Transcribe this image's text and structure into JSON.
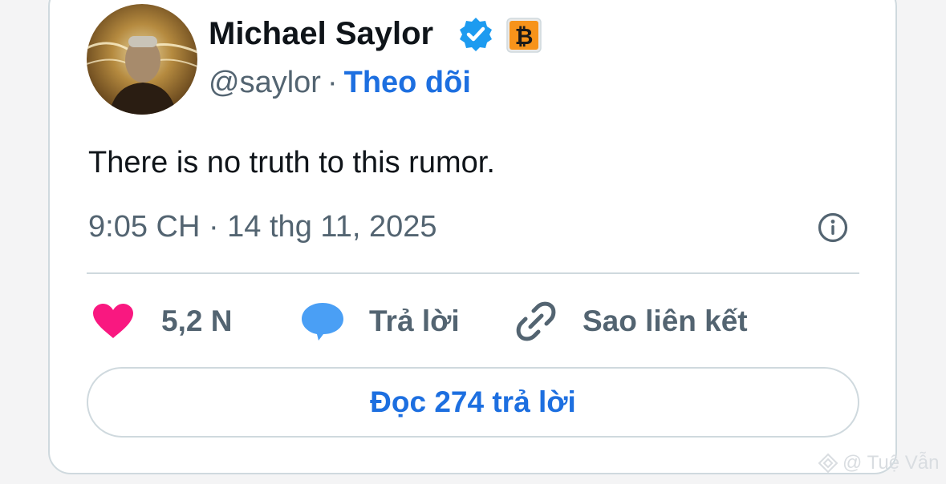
{
  "author": {
    "name": "Michael Saylor",
    "handle": "@saylor",
    "separator": "·",
    "follow_label": "Theo dõi",
    "verified_icon": "verified-badge-icon",
    "affiliate_icon": "bitcoin-icon"
  },
  "tweet": {
    "text": "There is no truth to this rumor.",
    "timestamp": "9:05 CH · 14 thg 11, 2025"
  },
  "actions": {
    "like_count": "5,2 N",
    "reply_label": "Trả lời",
    "copy_link_label": "Sao liên kết"
  },
  "read_replies_label": "Đọc 274 trả lời",
  "watermark": "@ Tuệ Vẫn",
  "colors": {
    "accent": "#1d6fe0",
    "heart": "#f91880",
    "reply_bubble": "#4a9ff5",
    "secondary_text": "#536471",
    "btc_badge": "#f7931a",
    "verified": "#1d9bf0"
  }
}
